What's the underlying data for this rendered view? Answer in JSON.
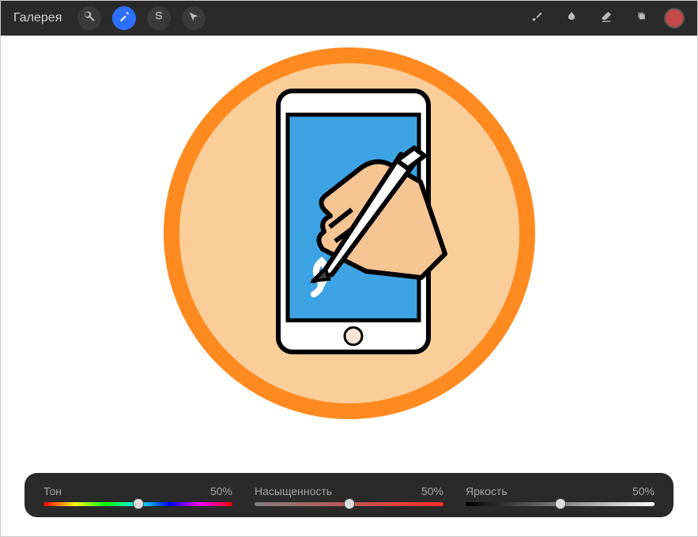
{
  "toolbar": {
    "gallery_label": "Галерея"
  },
  "colors": {
    "active_swatch": "#c44a4a"
  },
  "sliders": {
    "hue": {
      "label": "Тон",
      "value_text": "50%",
      "percent": 50
    },
    "saturation": {
      "label": "Насыщенность",
      "value_text": "50%",
      "percent": 50
    },
    "brightness": {
      "label": "Яркость",
      "value_text": "50%",
      "percent": 50
    }
  }
}
